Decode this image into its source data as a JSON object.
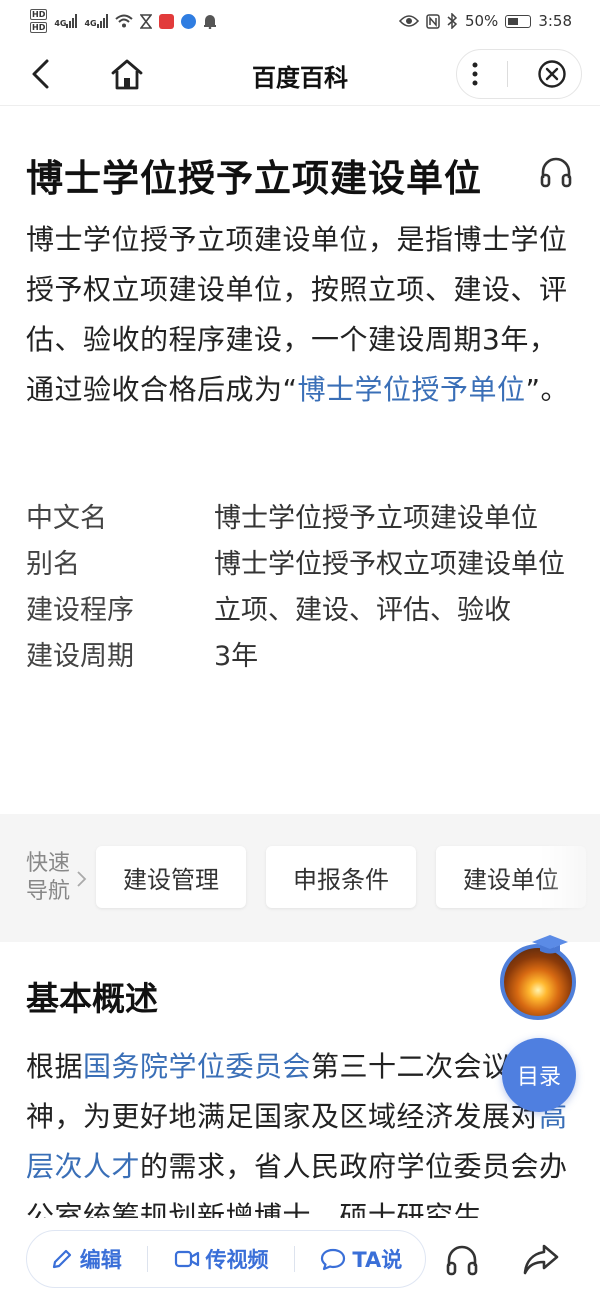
{
  "status_bar": {
    "hd1": "HD",
    "hd2": "HD",
    "net1": "4G",
    "net2": "4G",
    "battery_percent": "50%",
    "time": "3:58"
  },
  "nav": {
    "title": "百度百科"
  },
  "article": {
    "title": "博士学位授予立项建设单位",
    "summary_part1": "博士学位授予立项建设单位，是指博士学位授予权立项建设单位，按照立项、建设、评估、验收的程序建设，一个建设周期3年，通过验收合格后成为“",
    "summary_link": "博士学位授予单位",
    "summary_part2": "”。"
  },
  "infobox": [
    {
      "key": "中文名",
      "value": "博士学位授予立项建设单位"
    },
    {
      "key": "别名",
      "value": "博士学位授予权立项建设单位"
    },
    {
      "key": "建设程序",
      "value": "立项、建设、评估、验收"
    },
    {
      "key": "建设周期",
      "value": "3年"
    }
  ],
  "quick_nav": {
    "label": "快速导航",
    "items": [
      "建设管理",
      "申报条件",
      "建设单位"
    ]
  },
  "section": {
    "title": "基本概述",
    "t1": "根据",
    "link1": "国务院学位委员会",
    "t2": "第三十二次会议精神，为更好地满足国家及区域经济发展对",
    "link2": "高层次人才",
    "t3": "的需求，省人民政府学位委员会办公室统筹规划新增博士、硕士研究生"
  },
  "float": {
    "toc_label": "目录"
  },
  "bottom_bar": {
    "edit_label": "编辑",
    "video_label": "传视频",
    "ta_label": "TA说"
  },
  "colors": {
    "link": "#3a6fb7",
    "accent": "#3a6fd8",
    "toc_bg": "#4f7fe0"
  }
}
